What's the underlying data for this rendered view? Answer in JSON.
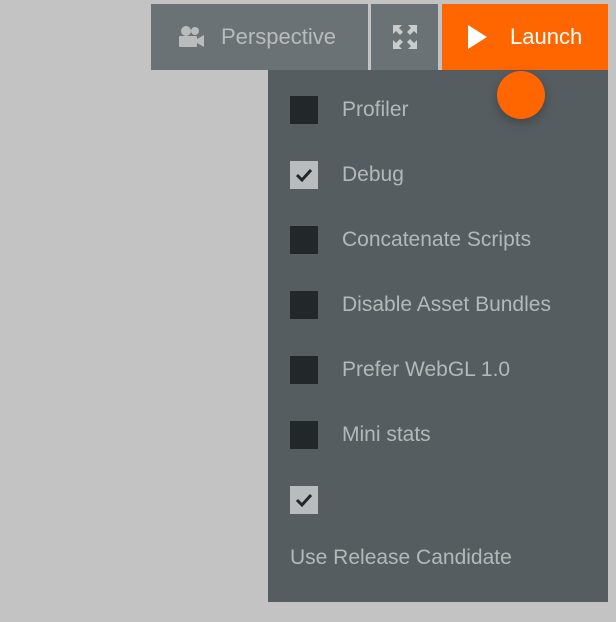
{
  "toolbar": {
    "perspective_label": "Perspective",
    "perspective_icon": "camera-icon",
    "fullscreen_icon": "expand-icon",
    "launch_label": "Launch",
    "launch_icon": "play-icon",
    "accent_color": "#ff6600"
  },
  "menu": {
    "items": [
      {
        "label": "Profiler",
        "checked": false
      },
      {
        "label": "Debug",
        "checked": true
      },
      {
        "label": "Concatenate Scripts",
        "checked": false
      },
      {
        "label": "Disable Asset Bundles",
        "checked": false
      },
      {
        "label": "Prefer WebGL 1.0",
        "checked": false
      },
      {
        "label": "Mini stats",
        "checked": false
      },
      {
        "label": "",
        "checked": true
      }
    ],
    "release_candidate_label": "Use Release Candidate"
  }
}
